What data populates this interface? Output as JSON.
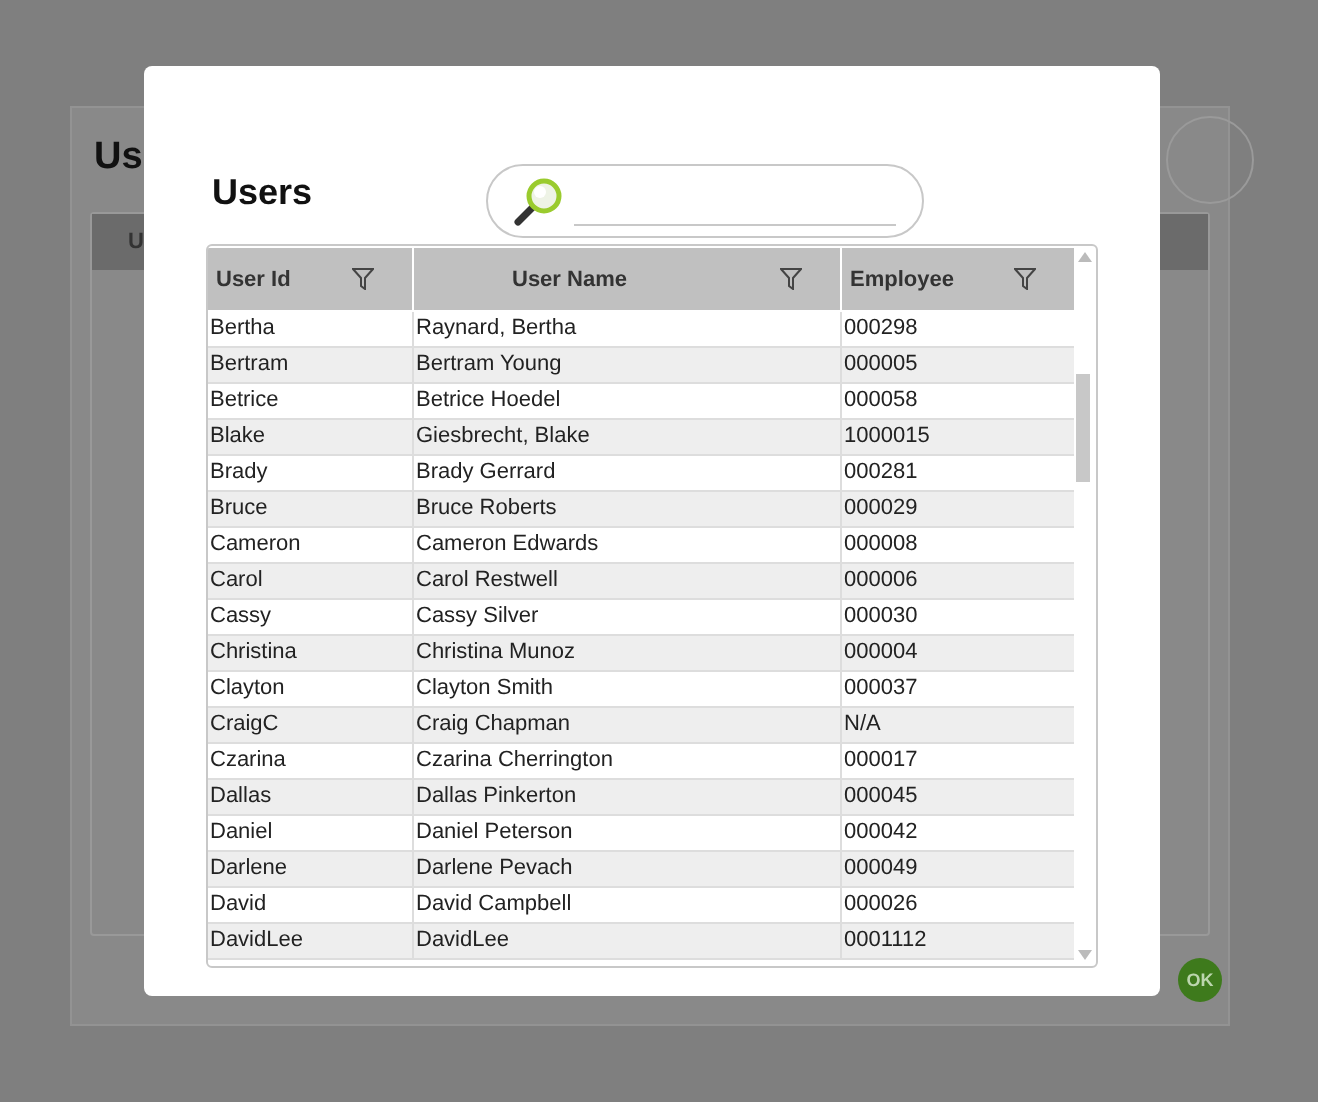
{
  "background_window": {
    "title": "Us",
    "table_header": "U",
    "ok_button": "OK"
  },
  "dialog": {
    "title": "Users",
    "table": {
      "columns": [
        {
          "label": "User Id",
          "filter": true
        },
        {
          "label": "User Name",
          "filter": true
        },
        {
          "label": "Employee",
          "filter": true
        }
      ],
      "rows": [
        [
          "Bertha",
          "Raynard, Bertha",
          "000298"
        ],
        [
          "Bertram",
          "Bertram Young",
          "000005"
        ],
        [
          "Betrice",
          "Betrice Hoedel",
          "000058"
        ],
        [
          "Blake",
          "Giesbrecht, Blake",
          "1000015"
        ],
        [
          "Brady",
          "Brady Gerrard",
          "000281"
        ],
        [
          "Bruce",
          "Bruce Roberts",
          "000029"
        ],
        [
          "Cameron",
          "Cameron Edwards",
          "000008"
        ],
        [
          "Carol",
          "Carol Restwell",
          "000006"
        ],
        [
          "Cassy",
          "Cassy Silver",
          "000030"
        ],
        [
          "Christina",
          "Christina Munoz",
          "000004"
        ],
        [
          "Clayton",
          "Clayton Smith",
          "000037"
        ],
        [
          "CraigC",
          "Craig Chapman",
          "N/A"
        ],
        [
          "Czarina",
          "Czarina Cherrington",
          "000017"
        ],
        [
          "Dallas",
          "Dallas Pinkerton",
          "000045"
        ],
        [
          "Daniel",
          "Daniel Peterson",
          "000042"
        ],
        [
          "Darlene",
          "Darlene Pevach",
          "000049"
        ],
        [
          "David",
          "David Campbell",
          "000026"
        ],
        [
          "DavidLee",
          "DavidLee",
          "0001112"
        ]
      ]
    }
  }
}
